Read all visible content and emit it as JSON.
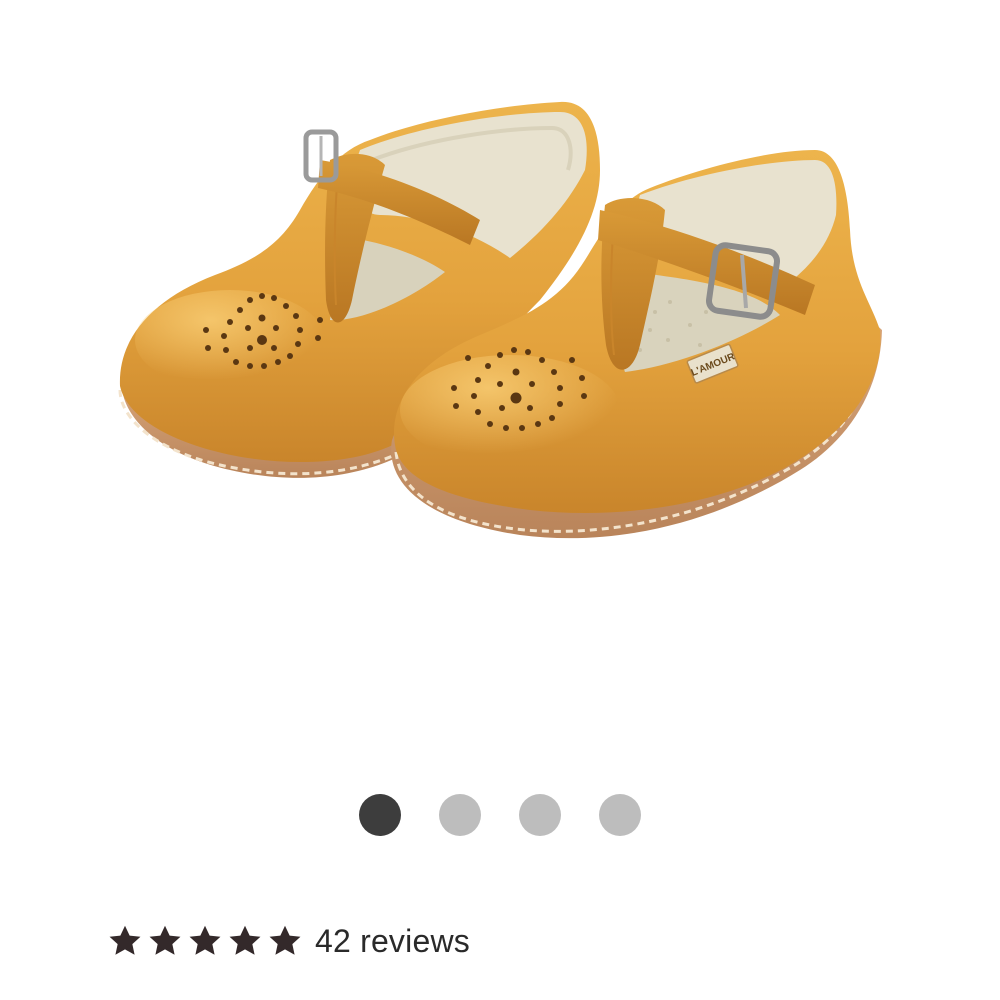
{
  "product": {
    "image_alt": "Mustard leather T-strap Mary Jane shoes with perforated toe",
    "brand_tag": "L'AMOUR",
    "shoe_color": "#E2A23E"
  },
  "carousel": {
    "total": 4,
    "active_index": 0,
    "active_color": "#3d3d3d",
    "inactive_color": "#bdbdbd"
  },
  "rating": {
    "stars": 5,
    "max_stars": 5,
    "star_color": "#33292a",
    "reviews_label": "42 reviews"
  }
}
